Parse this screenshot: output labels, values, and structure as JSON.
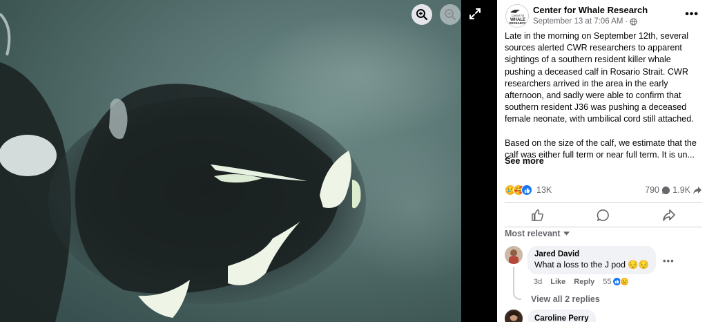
{
  "viewer": {
    "zoom_in_icon": "zoom-in-icon",
    "zoom_out_icon": "zoom-out-icon",
    "fullscreen_icon": "fullscreen-icon",
    "photo_subject": "killer-whale-photo"
  },
  "post": {
    "page_name": "Center for Whale Research",
    "timestamp": "September 13 at 7:06 AM",
    "separator": "·",
    "audience_icon": "globe-icon",
    "avatar_logo": {
      "line1": "Center for",
      "line2": "WHALE",
      "line3": "RESEARCH"
    },
    "paragraphs": [
      "Late in the morning on September 12th, several sources alerted CWR researchers to apparent sightings of a southern resident killer whale pushing a deceased calf in Rosario Strait. CWR researchers arrived in the area in the early afternoon, and sadly were able to confirm that southern resident J36 was pushing a deceased female neonate, with umbilical cord still attached.",
      "Based on the size of the calf, we estimate that the calf was either full term or near full term. It is un..."
    ],
    "see_more": "See more",
    "reaction_count": "13K",
    "comment_count": "790",
    "share_count": "1.9K"
  },
  "sort_label": "Most relevant",
  "comments": [
    {
      "author": "Jared David",
      "text": "What a loss to the J pod 😔😔",
      "age": "3d",
      "like_label": "Like",
      "reply_label": "Reply",
      "reaction_count": "55",
      "view_replies": "View all 2 replies"
    },
    {
      "author": "Caroline Perry"
    }
  ],
  "colors": {
    "water": "#56716f",
    "like_blue": "#1877f2",
    "emoji_yellow": "#f7b125",
    "secondary_text": "#65676b"
  }
}
